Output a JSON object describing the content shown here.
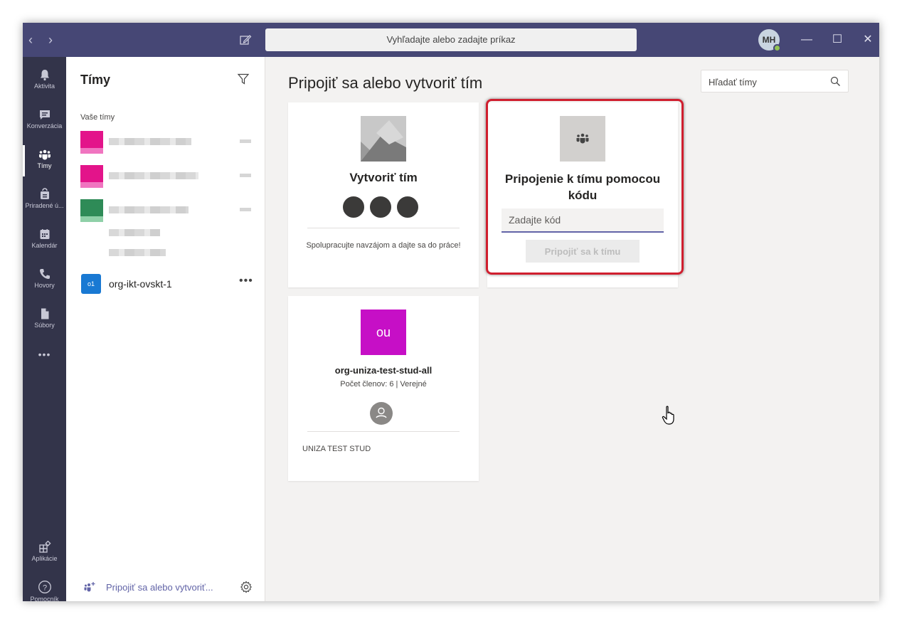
{
  "titlebar": {
    "back_icon": "chevron-left-icon",
    "forward_icon": "chevron-right-icon",
    "compose_icon": "compose-icon",
    "search_placeholder": "Vyhľadajte alebo zadajte príkaz",
    "avatar_initials": "MH",
    "minimize": "—",
    "maximize": "☐",
    "close": "✕",
    "bg_color": "#464775"
  },
  "rail": {
    "items": [
      {
        "label": "Aktivita",
        "icon": "bell-icon"
      },
      {
        "label": "Konverzácia",
        "icon": "chat-icon"
      },
      {
        "label": "Tímy",
        "icon": "teams-icon"
      },
      {
        "label": "Priradené ú...",
        "icon": "assignments-icon"
      },
      {
        "label": "Kalendár",
        "icon": "calendar-icon"
      },
      {
        "label": "Hovory",
        "icon": "phone-icon"
      },
      {
        "label": "Súbory",
        "icon": "file-icon"
      },
      {
        "label": "•••",
        "icon": "more-icon"
      },
      {
        "label": "Aplikácie",
        "icon": "apps-icon"
      },
      {
        "label": "Pomocník",
        "icon": "help-icon"
      }
    ],
    "active": "Tímy",
    "bg_color": "#33344a"
  },
  "teams_panel": {
    "title": "Tímy",
    "section_label": "Vaše tímy",
    "team": {
      "initials": "o1",
      "name": "org-ikt-ovskt-1",
      "more": "•••"
    },
    "join_link": "Pripojiť sa alebo vytvoriť...",
    "accent": "#6264a7"
  },
  "main": {
    "title": "Pripojiť sa alebo vytvoriť tím",
    "search_placeholder": "Hľadať tímy",
    "create_card": {
      "title": "Vytvoriť tím",
      "description": "Spolupracujte navzájom a dajte sa do práce!"
    },
    "join_card": {
      "title": "Pripojenie k tímu pomocou kódu",
      "input_placeholder": "Zadajte kód",
      "button": "Pripojiť sa k tímu"
    },
    "team_card": {
      "initials": "ou",
      "name": "org-uniza-test-stud-all",
      "meta": "Počet členov: 6 | Verejné",
      "description": "UNIZA TEST STUD",
      "color": "#c60fc6"
    }
  }
}
